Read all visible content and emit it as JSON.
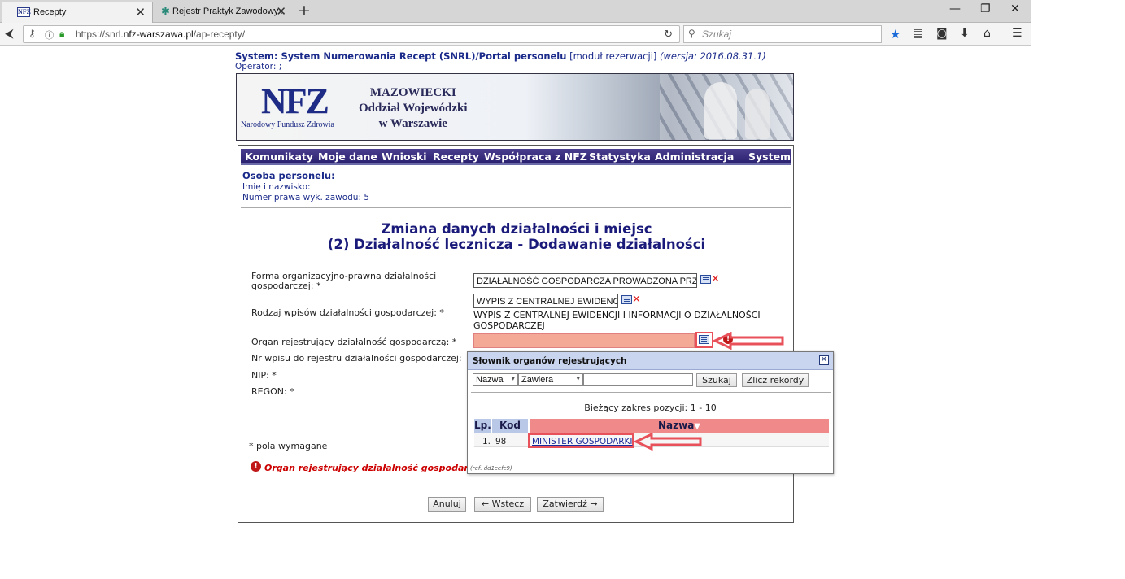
{
  "browser": {
    "tabs": [
      {
        "label": "Recepty",
        "favicon": "NFZ"
      },
      {
        "label": "Rejestr Praktyk Zawodowy...",
        "favicon": "caduceus-icon"
      }
    ],
    "new_tab": "+",
    "url_prefix": "https://snrl.",
    "url_domain": "nfz-warszawa.pl",
    "url_suffix": "/ap-recepty/",
    "search_placeholder": "Szukaj"
  },
  "page": {
    "system_label": "System: System Numerowania Recept (SNRL)/Portal personelu",
    "module": "[moduł rezerwacji]",
    "version": "(wersja: 2016.08.31.1)",
    "operator": "Operator: ;",
    "banner": {
      "logo": "NFZ",
      "logo_sub": "Narodowy Fundusz Zdrowia",
      "line1": "MAZOWIECKI",
      "line2": "Oddział Wojewódzki",
      "line3": "w Warszawie"
    },
    "menu": [
      "Komunikaty",
      "Moje dane",
      "Wnioski",
      "Recepty",
      "Współpraca z NFZ",
      "Statystyka",
      "Administracja",
      "System"
    ],
    "person": {
      "heading": "Osoba personelu:",
      "name_label": "Imię i nazwisko:",
      "license_label": "Numer prawa wyk. zawodu: 5"
    },
    "title1": "Zmiana danych działalności i miejsc",
    "title2": "(2) Działalność lecznicza - Dodawanie działalności",
    "form": {
      "forma_label_1": "Forma organizacyjno-prawna działalności",
      "forma_label_2": "gospodarczej: *",
      "forma_value": "DZIAŁALNOŚĆ GOSPODARCZA PROWADZONA PRZ",
      "rodzaj_value": "WYPIS Z CENTRALNEJ EWIDENC.",
      "rodzaj_label": "Rodzaj wpisów działalności gospodarczej: *",
      "rodzaj_desc_1": "WYPIS Z CENTRALNEJ EWIDENCJI I INFORMACJI O DZIAŁALNOŚCI",
      "rodzaj_desc_2": "GOSPODARCZEJ",
      "organ_label": "Organ rejestrujący działalność gospodarczą: *",
      "nr_wpisu_label": "Nr wpisu do rejestru działalności gospodarczej:",
      "nip_label": "NIP: *",
      "regon_label": "REGON: *",
      "required_note": "* pola wymagane",
      "error_text": "Organ rejestrujący działalność gospodarczą –"
    },
    "buttons": {
      "cancel": "Anuluj",
      "back": "← Wstecz",
      "confirm": "Zatwierdź →"
    }
  },
  "popup": {
    "title": "Słownik organów rejestrujących",
    "field_select": "Nazwa",
    "mode_select": "Zawiera",
    "search_value": "",
    "search_button": "Szukaj",
    "count_button": "Zlicz rekordy",
    "range_text": "Bieżący zakres pozycji: 1 - 10",
    "columns": [
      "Lp.",
      "Kod",
      "Nazwa"
    ],
    "rows": [
      {
        "lp": "1.",
        "kod": "98",
        "nazwa": "MINISTER GOSPODARKI"
      }
    ],
    "ref": "(ref. dd1cefc9)"
  },
  "colors": {
    "menu_bg": "#2a2070",
    "title_blue": "#1a1a7a",
    "error_red": "#cc0000",
    "highlight": "#e8505a",
    "popup_header": "#c9d5ee",
    "table_header_sort": "#f08a8a"
  }
}
